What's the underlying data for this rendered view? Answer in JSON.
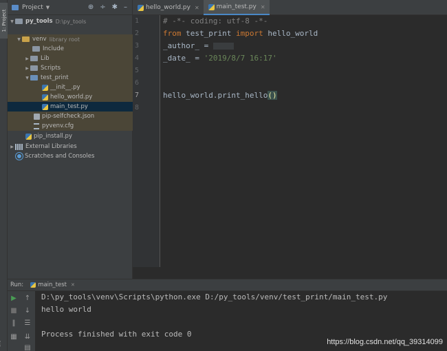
{
  "left_strip": {
    "tab_label": "1: Project",
    "bottom_label": "ure"
  },
  "project_panel": {
    "title": "Project",
    "tools": {
      "locate": "⊕",
      "collapse": "÷",
      "settings": "✱",
      "hide": "–"
    },
    "tree": [
      {
        "label": "py_tools",
        "extra": "D:\\py_tools"
      },
      {
        "label": "venv",
        "extra": "library root"
      },
      {
        "label": "Include"
      },
      {
        "label": "Lib"
      },
      {
        "label": "Scripts"
      },
      {
        "label": "test_print"
      },
      {
        "label": "__init__.py"
      },
      {
        "label": "hello_world.py"
      },
      {
        "label": "main_test.py"
      },
      {
        "label": "pip-selfcheck.json"
      },
      {
        "label": "pyvenv.cfg"
      },
      {
        "label": "pip_install.py"
      },
      {
        "label": "External Libraries"
      },
      {
        "label": "Scratches and Consoles"
      }
    ]
  },
  "editor": {
    "tabs": [
      {
        "label": "hello_world.py"
      },
      {
        "label": "main_test.py"
      }
    ],
    "line_numbers": [
      "1",
      "2",
      "3",
      "4",
      "5",
      "6",
      "7",
      "8"
    ],
    "code": {
      "l1": "# -*- coding: utf-8 -*-",
      "l2_kw1": "from",
      "l2_mod": " test_print ",
      "l2_kw2": "import",
      "l2_name": " hello_world",
      "l3": "_author_ = ",
      "l4_name": "_date_ = ",
      "l4_str": "'2019/8/7 16:17'",
      "l7_call": "hello_world.print_hello",
      "l7_paren": "()"
    }
  },
  "run_panel": {
    "label": "Run:",
    "tab_label": "main_test",
    "output": [
      "D:\\py_tools\\venv\\Scripts\\python.exe D:/py_tools/venv/test_print/main_test.py",
      "hello world",
      "",
      "Process finished with exit code 0"
    ]
  },
  "watermark": "https://blog.csdn.net/qq_39314099"
}
